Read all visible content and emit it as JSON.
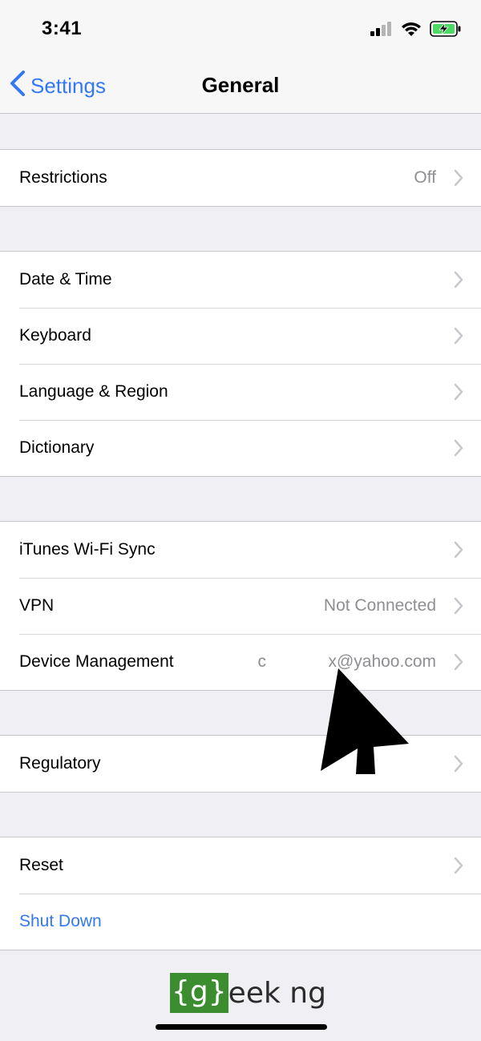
{
  "status_bar": {
    "time": "3:41",
    "icons": [
      "cellular-signal-icon",
      "wifi-icon",
      "battery-charging-icon"
    ]
  },
  "nav": {
    "back_label": "Settings",
    "title": "General"
  },
  "groups": [
    {
      "rows": [
        {
          "label": "Restrictions",
          "value": "Off"
        }
      ]
    },
    {
      "rows": [
        {
          "label": "Date & Time"
        },
        {
          "label": "Keyboard"
        },
        {
          "label": "Language & Region"
        },
        {
          "label": "Dictionary"
        }
      ]
    },
    {
      "rows": [
        {
          "label": "iTunes Wi-Fi Sync"
        },
        {
          "label": "VPN",
          "value": "Not Connected"
        },
        {
          "label": "Device Management",
          "value_left": "c",
          "value_right": "x@yahoo.com"
        }
      ]
    },
    {
      "rows": [
        {
          "label": "Regulatory"
        }
      ]
    },
    {
      "rows": [
        {
          "label": "Reset"
        },
        {
          "label": "Shut Down"
        }
      ]
    }
  ],
  "watermark": {
    "boxed": "{g}",
    "rest": "eek ng"
  },
  "colors": {
    "accent": "#3478f6",
    "background": "#efeff4",
    "watermark_green": "#3c8d2f"
  }
}
